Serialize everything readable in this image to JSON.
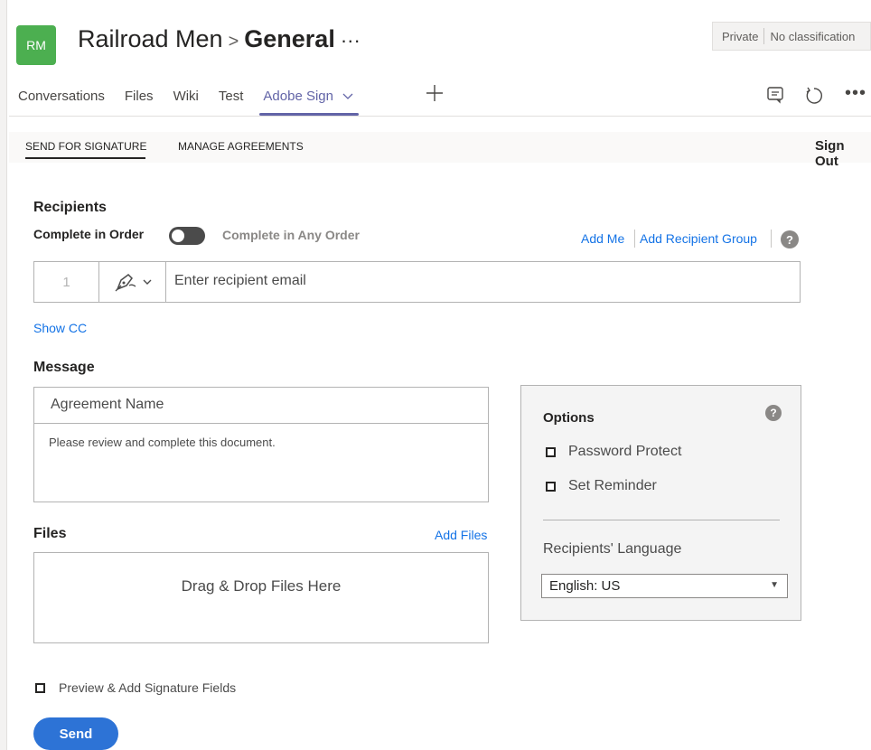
{
  "team": {
    "avatar_initials": "RM",
    "avatar_color": "#4caf50",
    "name": "Railroad Men",
    "separator": ">",
    "channel": "General",
    "more": "···"
  },
  "privacy": {
    "visibility": "Private",
    "classification": "No classification"
  },
  "tabs": [
    {
      "label": "Conversations",
      "active": false
    },
    {
      "label": "Files",
      "active": false
    },
    {
      "label": "Wiki",
      "active": false
    },
    {
      "label": "Test",
      "active": false
    },
    {
      "label": "Adobe Sign",
      "active": true
    }
  ],
  "toolbar_icons": [
    "chat-icon",
    "refresh-icon",
    "more-icon"
  ],
  "subnav": {
    "send_for_signature": "SEND FOR SIGNATURE",
    "manage_agreements": "MANAGE AGREEMENTS",
    "sign_out": "Sign Out"
  },
  "recipients": {
    "heading": "Recipients",
    "complete_in_order": "Complete in Order",
    "complete_any_order": "Complete in Any Order",
    "add_me": "Add Me",
    "add_group": "Add Recipient Group",
    "row_number": "1",
    "email_placeholder": "Enter recipient email",
    "show_cc": "Show CC"
  },
  "message": {
    "heading": "Message",
    "agreement_name": "Agreement Name",
    "body": "Please review and complete this document."
  },
  "files": {
    "heading": "Files",
    "add_files": "Add Files",
    "drop_text": "Drag & Drop Files Here"
  },
  "options": {
    "heading": "Options",
    "password_protect": "Password Protect",
    "set_reminder": "Set Reminder",
    "language_label": "Recipients' Language",
    "language_value": "English: US"
  },
  "preview_label": "Preview & Add Signature Fields",
  "send_label": "Send",
  "colors": {
    "accent_purple": "#6264a7",
    "link_blue": "#1473e6",
    "send_blue": "#2d73d6"
  }
}
